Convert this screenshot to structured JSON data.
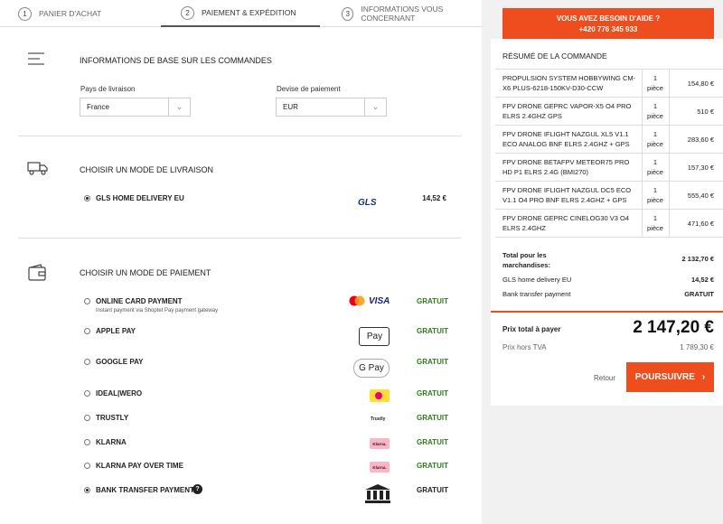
{
  "steps": [
    {
      "num": "1",
      "label": "PANIER D'ACHAT"
    },
    {
      "num": "2",
      "label": "PAIEMENT & EXPÉDITION"
    },
    {
      "num": "3",
      "label": "INFORMATIONS VOUS CONCERNANT"
    }
  ],
  "basic": {
    "title": "INFORMATIONS DE BASE SUR LES COMMANDES",
    "country_label": "Pays de livraison",
    "country_value": "France",
    "currency_label": "Devise de paiement",
    "currency_value": "EUR"
  },
  "shipping": {
    "title": "CHOISIR UN MODE DE LIVRAISON",
    "options": [
      {
        "label": "GLS HOME DELIVERY EU",
        "logo": "GLS",
        "price": "14,52 €"
      }
    ]
  },
  "payment": {
    "title": "CHOISIR UN MODE DE PAIEMENT",
    "options": [
      {
        "label": "ONLINE CARD PAYMENT",
        "sub": "Instant payment via Shoptet Pay payment gateway",
        "price": "GRATUIT",
        "icon": "mastercard-visa-icon"
      },
      {
        "label": "APPLE PAY",
        "price": "GRATUIT",
        "badge": "Pay"
      },
      {
        "label": "GOOGLE PAY",
        "price": "GRATUIT",
        "badge": "G Pay"
      },
      {
        "label": "IDEAL|WERO",
        "price": "GRATUIT",
        "icon": "ideal-wero-icon"
      },
      {
        "label": "TRUSTLY",
        "price": "GRATUIT",
        "badge": "Trustly"
      },
      {
        "label": "KLARNA",
        "price": "GRATUIT",
        "badge": "Klarna."
      },
      {
        "label": "KLARNA PAY OVER TIME",
        "price": "GRATUIT",
        "badge": "Klarna."
      },
      {
        "label": "BANK TRANSFER PAYMENT",
        "price": "GRATUIT",
        "icon": "bank-icon"
      }
    ]
  },
  "help": {
    "line1": "VOUS AVEZ BESOIN D'AIDE ?",
    "line2": "+420 776 345 933"
  },
  "summary": {
    "title": "RÉSUMÉ DE LA COMMANDE",
    "items": [
      {
        "name": "PROPULSION SYSTEM HOBBYWING CM-X6 PLUS-6218-150KV-D30-CCW",
        "qty1": "1",
        "qty2": "pièce",
        "price": "154,80 €"
      },
      {
        "name": "FPV DRONE GEPRC VAPOR-X5 O4 PRO ELRS 2.4GHZ GPS",
        "qty1": "1",
        "qty2": "pièce",
        "price": "510 €"
      },
      {
        "name": "FPV DRONE IFLIGHT NAZGUL XL5 V1.1 ECO ANALOG BNF ELRS 2.4GHZ + GPS",
        "qty1": "1",
        "qty2": "pièce",
        "price": "283,60 €"
      },
      {
        "name": "FPV DRONE BETAFPV METEOR75 PRO HD P1 ELRS 2.4G (BMI270)",
        "qty1": "1",
        "qty2": "pièce",
        "price": "157,30 €"
      },
      {
        "name": "FPV DRONE IFLIGHT NAZGUL DC5 ECO V1.1 O4 PRO BNF ELRS 2.4GHZ + GPS",
        "qty1": "1",
        "qty2": "pièce",
        "price": "555,40 €"
      },
      {
        "name": "FPV DRONE GEPRC CINELOG30 V3 O4 ELRS 2.4GHZ",
        "qty1": "1",
        "qty2": "pièce",
        "price": "471,60 €"
      }
    ],
    "goods_label": "Total pour les marchandises:",
    "goods_value": "2 132,70 €",
    "shipping_label": "GLS home delivery EU",
    "shipping_value": "14,52 €",
    "payment_label": "Bank transfer payment",
    "payment_value": "GRATUIT",
    "total_label": "Prix total à payer",
    "total_value": "2 147,20 €",
    "net_label": "Prix hors TVA",
    "net_value": "1 789,30 €",
    "back_label": "Retour",
    "continue_label": "POURSUIVRE"
  }
}
